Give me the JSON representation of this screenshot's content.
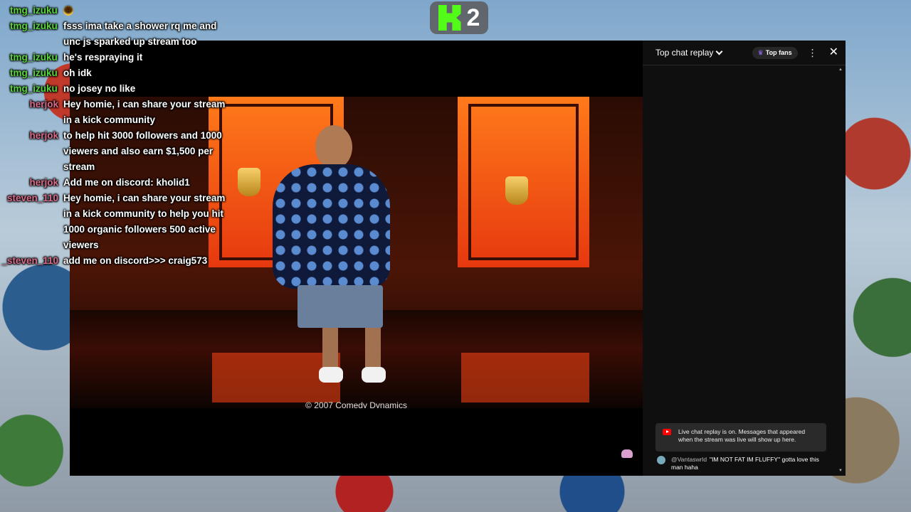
{
  "kick": {
    "viewer_count": "2"
  },
  "overlay_chat": [
    {
      "user": "tmg_izuku",
      "text": "",
      "emoji": "😂",
      "color": "green"
    },
    {
      "user": "tmg_izuku",
      "text": "fsss ima take a shower rq me and unc js sparked up stream too",
      "color": "green"
    },
    {
      "user": "tmg_izuku",
      "text": "he's respraying it",
      "color": "green"
    },
    {
      "user": "tmg_izuku",
      "text": "oh idk",
      "color": "green"
    },
    {
      "user": "tmg_izuku",
      "text": "no josey no like",
      "color": "green"
    },
    {
      "user": "herjok",
      "text": "Hey homie, i can share your stream in a kick community",
      "color": "pink"
    },
    {
      "user": "herjok",
      "text": "to help hit 3000 followers and 1000 viewers and also earn $1,500 per stream",
      "color": "pink"
    },
    {
      "user": "herjok",
      "text": "Add me on discord: kholid1",
      "color": "pink"
    },
    {
      "user": "steven_110",
      "text": "Hey homie, i can share your stream in a kick community to help you hit 1000 organic followers 500 active viewers",
      "color": "pink"
    },
    {
      "user": "_steven_110",
      "text": "add me on discord>>> craig573",
      "color": "pink"
    }
  ],
  "video": {
    "copyright": "© 2007 Comedy Dynamics"
  },
  "yt_chat": {
    "title": "Top chat replay",
    "top_fans_label": "Top fans",
    "replay_notice": "Live chat replay is on. Messages that appeared when the stream was live will show up here.",
    "messages": [
      {
        "author": "@Vantaswrld",
        "text": "\"IM NOT FAT IM FLUFFY\" gotta love this man haha"
      }
    ]
  },
  "colors": {
    "kick_green": "#53fc18",
    "user_green": "#58d63c",
    "user_pink": "#d86a8a",
    "yt_red": "#ff0000"
  }
}
